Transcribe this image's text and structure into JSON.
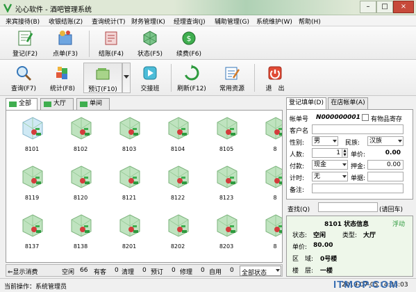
{
  "window": {
    "title": "沁心软件 - 酒吧管理系统",
    "buttons": [
      "–",
      "□",
      "×"
    ],
    "icon": "logo-icon"
  },
  "menu": [
    "来宾接待(B)",
    "收银结账(Z)",
    "查询统计(T)",
    "财务管理(K)",
    "经理查询(J)",
    "辅助管理(G)",
    "系统维护(W)",
    "帮助(H)"
  ],
  "toolbar1": [
    {
      "label": "登记(F2)",
      "icon": "register-icon"
    },
    {
      "label": "点单(F3)",
      "icon": "order-icon"
    },
    {
      "label": "结账(F4)",
      "icon": "checkout-icon"
    },
    {
      "label": "状态(F5)",
      "icon": "status-icon"
    },
    {
      "label": "续费(F6)",
      "icon": "renew-icon"
    }
  ],
  "toolbar2": [
    {
      "label": "查询(F7)",
      "icon": "search-icon"
    },
    {
      "label": "统计(F8)",
      "icon": "stats-icon"
    },
    {
      "label": "预订(F10)",
      "icon": "reserve-icon"
    },
    {
      "label": "交接班",
      "icon": "shift-icon"
    },
    {
      "label": "刷新(F12)",
      "icon": "refresh-icon"
    },
    {
      "label": "常用资源",
      "icon": "resources-icon"
    },
    {
      "label": "退　出",
      "icon": "exit-icon"
    }
  ],
  "area_tabs": [
    "全部",
    "大厅",
    "单间"
  ],
  "rooms": [
    [
      "8101",
      "8102",
      "8103",
      "8104",
      "8105",
      "8"
    ],
    [
      "8119",
      "8120",
      "8121",
      "8122",
      "8123",
      "8"
    ],
    [
      "8137",
      "8138",
      "8201",
      "8202",
      "8203",
      "8"
    ]
  ],
  "status_bar": {
    "toggle": "⇐显示消费",
    "idle": "空闲",
    "idle_count": "66",
    "occupied": "有客",
    "occupied_count": "0",
    "cleaning": "清理",
    "cleaning_count": "0",
    "reserved": "预订",
    "reserved_count": "0",
    "repair": "修理",
    "repair_count": "0",
    "self_use": "自用",
    "self_use_count": "0",
    "filter": "全部状态"
  },
  "right_tabs": [
    "登记填单(D)",
    "在店帐单(A)"
  ],
  "form": {
    "account_label": "帐单号",
    "account_value": "N000000001",
    "deposit_label": "有物品寄存",
    "guest_label": "客户名",
    "gender_label": "性别:",
    "gender_value": "男",
    "ethnic_label": "民族:",
    "ethnic_value": "汉族",
    "people_label": "人数:",
    "people_value": "1",
    "price_label": "单价:",
    "price_value": "0.00",
    "pay_label": "付款:",
    "pay_value": "现金",
    "deposit_amt_label": "押金:",
    "deposit_amt_value": "0.00",
    "timing_label": "计时:",
    "timing_value": "无",
    "voucher_label": "单据:",
    "note_label": "备注:"
  },
  "find": {
    "label": "查找(Q)",
    "button": "(请回车)"
  },
  "room_info": {
    "title": "8101 状态信息",
    "float": "浮动",
    "status_label": "状态:",
    "status_value": "空闲",
    "type_label": "类型:",
    "type_value": "大厅",
    "price_label": "单价:",
    "price_value": "80.00",
    "area_label": "区　域:",
    "area_value": "0号楼",
    "floor_label": "楼　层:",
    "floor_value": "一楼"
  },
  "footer": {
    "operator": "当前操作：系统管理员",
    "datetime": "2019-07-05 14:33:03",
    "watermark": "ITMOP.COM"
  },
  "colors": {
    "accent_green": "#2e9a3e",
    "title_bg": "#dfe8d6",
    "info_bg": "#eef7ea"
  }
}
